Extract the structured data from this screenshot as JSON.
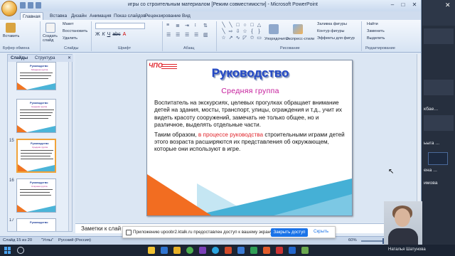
{
  "window": {
    "title": "игры со строительным материалом [Режим совместимости] - Microsoft PowerPoint",
    "minimize": "–",
    "maximize": "□",
    "close": "✕"
  },
  "ribbon_tabs": [
    "Главная",
    "Вставка",
    "Дизайн",
    "Анимация",
    "Показ слайдов",
    "Рецензирование",
    "Вид"
  ],
  "ribbon": {
    "paste": "Вставить",
    "create_slide": "Создать слайд",
    "layout": "Макет",
    "reset": "Восстановить",
    "delete": "Удалить",
    "arrange": "Упорядочить",
    "quick_styles": "Экспресс-стили",
    "shape_fill": "Заливка фигуры",
    "shape_outline": "Контур фигуры",
    "shape_effects": "Эффекты для фигур",
    "find": "Найти",
    "replace": "Заменить",
    "select": "Выделить",
    "groups": {
      "clipboard": "Буфер обмена",
      "slides": "Слайды",
      "font": "Шрифт",
      "paragraph": "Абзац",
      "drawing": "Рисование",
      "editing": "Редактирование"
    }
  },
  "panel": {
    "tabs": [
      "Слайды",
      "Структура"
    ],
    "slides": [
      {
        "num": "14",
        "title": "Руководство",
        "subtitle": "Младшая группа"
      },
      {
        "num": "",
        "title": "Руководство",
        "subtitle": "Средняя группа"
      },
      {
        "num": "15",
        "title": "Руководство",
        "subtitle": "Средняя группа"
      },
      {
        "num": "16",
        "title": "Руководство",
        "subtitle": "Старшая группа"
      },
      {
        "num": "17",
        "title": "Руководство",
        "subtitle": ""
      }
    ]
  },
  "slide": {
    "logo": "ЧПО",
    "title": "Руководство",
    "subtitle": "Средняя группа",
    "para1": "Воспитатель на экскурсиях, целевых прогулках обращает внимание детей на здания, мосты, транспорт, улицы, ограждения и т.д., учит их видеть красоту сооружений, замечать не только общее, но и различное, выделять отдельные части.",
    "para2_start": "Таким образом, ",
    "para2_highlight": "в процессе руководства",
    "para2_end": " строительными играми детей этого возраста расширяются их представления об окружающем, которые они используют в игре."
  },
  "notes": {
    "placeholder": "Заметки к слай"
  },
  "status": {
    "slide_info": "Слайд 15 из 20",
    "theme": "\"Углы\"",
    "language": "Русский (Россия)",
    "zoom": "60%"
  },
  "share_bar": {
    "message": "Приложению upoobr2.ktalk.ru предоставлен доступ к вашему экрану.",
    "stop_button": "Закрыть доступ",
    "hide_button": "Скрыть"
  },
  "meeting": {
    "participants": [
      "кбае...",
      "ьыга ...",
      "ена ...",
      "имова"
    ],
    "presenter": "Наталья Шатунова"
  },
  "colors": {
    "title_blue": "#2348c6",
    "subtitle_magenta": "#c41a9a",
    "highlight_red": "#e0242b",
    "accent_orange": "#f26d21",
    "accent_blue": "#45b0d6"
  }
}
